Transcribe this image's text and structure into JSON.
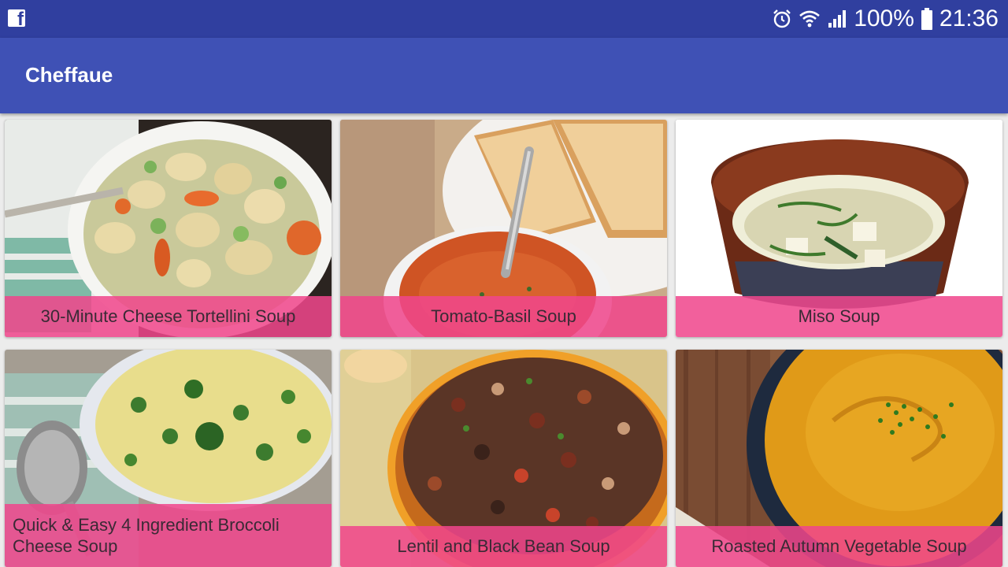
{
  "status_bar": {
    "left_icon": "facebook-icon",
    "icons": [
      "alarm-icon",
      "wifi-icon",
      "signal-icon",
      "battery-icon"
    ],
    "battery": "100%",
    "time": "21:36",
    "color": "#303f9f"
  },
  "app_bar": {
    "title": "Cheffaue",
    "color": "#3f51b5"
  },
  "recipes": [
    {
      "title": "30-Minute Cheese Tortellini Soup",
      "image": "tortellini-soup-photo"
    },
    {
      "title": "Tomato-Basil Soup",
      "image": "tomato-basil-soup-photo"
    },
    {
      "title": "Miso Soup",
      "image": "miso-soup-photo"
    },
    {
      "title": "Quick & Easy 4 Ingredient Broccoli Cheese Soup",
      "image": "broccoli-cheese-soup-photo"
    },
    {
      "title": "Lentil and Black Bean Soup",
      "image": "lentil-bean-soup-photo"
    },
    {
      "title": "Roasted Autumn Vegetable Soup",
      "image": "autumn-vegetable-soup-photo"
    }
  ],
  "caption_color": "#f0468c"
}
